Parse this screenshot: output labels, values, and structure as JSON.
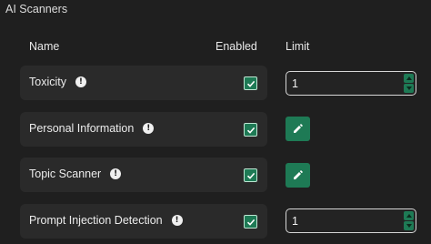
{
  "section": {
    "title": "AI Scanners"
  },
  "headers": {
    "name": "Name",
    "enabled": "Enabled",
    "limit": "Limit"
  },
  "colors": {
    "accent": "#1e7a55",
    "row_bg": "#2a2a2a",
    "page_bg": "#1f1f1f"
  },
  "rows": [
    {
      "label": "Toxicity",
      "enabled": true,
      "limit_control": "stepper",
      "limit_value": "1"
    },
    {
      "label": "Personal Information",
      "enabled": true,
      "limit_control": "edit-button"
    },
    {
      "label": "Topic Scanner",
      "enabled": true,
      "limit_control": "edit-button"
    },
    {
      "label": "Prompt Injection Detection",
      "enabled": true,
      "limit_control": "stepper",
      "limit_value": "1"
    }
  ],
  "icons": {
    "info": "info-icon",
    "edit": "pencil-icon",
    "check": "check-icon",
    "up": "caret-up-icon",
    "down": "caret-down-icon"
  }
}
